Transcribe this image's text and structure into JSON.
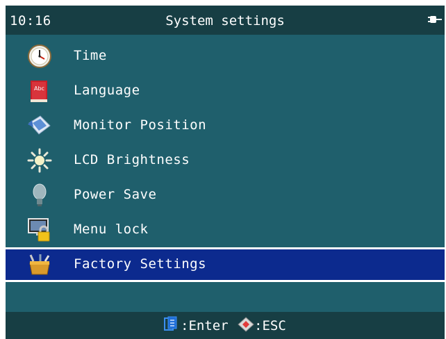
{
  "status": {
    "time": "10:16"
  },
  "header": {
    "title": "System settings"
  },
  "menu": {
    "items": [
      {
        "label": "Time",
        "icon": "clock-icon"
      },
      {
        "label": "Language",
        "icon": "language-book-icon"
      },
      {
        "label": "Monitor Position",
        "icon": "monitor-position-icon"
      },
      {
        "label": "LCD Brightness",
        "icon": "sun-brightness-icon"
      },
      {
        "label": "Power Save",
        "icon": "lightbulb-icon"
      },
      {
        "label": "Menu lock",
        "icon": "monitor-lock-icon"
      },
      {
        "label": "Factory Settings",
        "icon": "toolbox-icon",
        "selected": true
      }
    ]
  },
  "footer": {
    "enter_label": ":Enter",
    "esc_label": ":ESC"
  },
  "colors": {
    "background": "#1f5f6c",
    "bars": "#173e44",
    "selection": "#0c2a8e",
    "text": "#ffffff"
  }
}
